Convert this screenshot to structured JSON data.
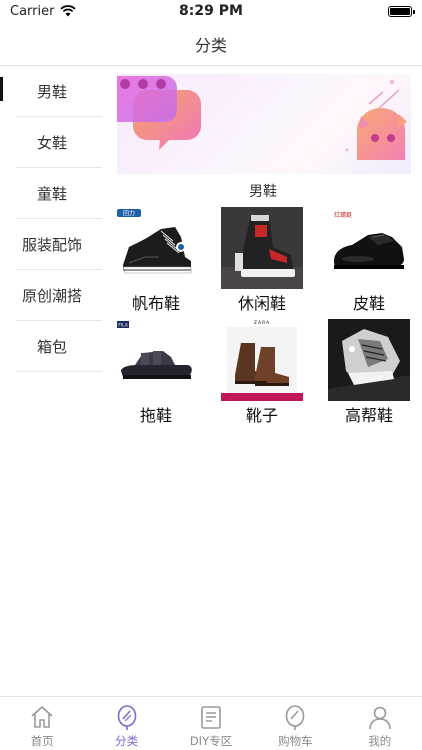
{
  "status_bar": {
    "carrier": "Carrier",
    "time": "8:29 PM"
  },
  "nav": {
    "title": "分类"
  },
  "sidebar": {
    "items": [
      {
        "label": "男鞋",
        "active": true
      },
      {
        "label": "女鞋"
      },
      {
        "label": "童鞋"
      },
      {
        "label": "服装配饰"
      },
      {
        "label": "原创潮搭"
      },
      {
        "label": "箱包"
      }
    ]
  },
  "main": {
    "section_title": "男鞋",
    "products": [
      {
        "label": "帆布鞋",
        "logo_text": "回力"
      },
      {
        "label": "休闲鞋"
      },
      {
        "label": "皮鞋",
        "logo_text": "红蜻蜓"
      },
      {
        "label": "拖鞋",
        "logo_text": "FILA"
      },
      {
        "label": "靴子",
        "logo_text": "ZARA"
      },
      {
        "label": "高帮鞋"
      }
    ]
  },
  "tab_bar": {
    "items": [
      {
        "label": "首页",
        "icon": "home-icon"
      },
      {
        "label": "分类",
        "icon": "category-icon",
        "active": true
      },
      {
        "label": "DIY专区",
        "icon": "diy-icon"
      },
      {
        "label": "购物车",
        "icon": "cart-icon"
      },
      {
        "label": "我的",
        "icon": "profile-icon"
      }
    ]
  },
  "colors": {
    "accent": "#7a6bd6",
    "banner_pink": "#f07ab8",
    "banner_orange": "#f59a6a"
  }
}
